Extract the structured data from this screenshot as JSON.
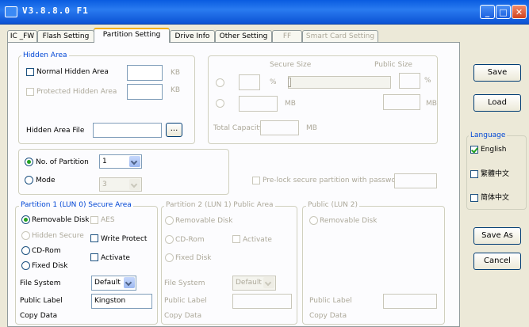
{
  "window": {
    "title": "V3.8.8.0 F1",
    "minimize": "_",
    "maximize": "□",
    "close": "✕"
  },
  "tabs": [
    {
      "label": "IC _FW",
      "state": "normal"
    },
    {
      "label": "Flash Setting",
      "state": "normal"
    },
    {
      "label": "Partition Setting",
      "state": "active"
    },
    {
      "label": "Drive Info",
      "state": "normal"
    },
    {
      "label": "Other Setting",
      "state": "normal"
    },
    {
      "label": "FF",
      "state": "disabled"
    },
    {
      "label": "Smart Card Setting",
      "state": "disabled"
    }
  ],
  "hidden_area": {
    "group_label": "Hidden Area",
    "normal_hidden_label": "Normal Hidden Area",
    "normal_hidden_unit": "KB",
    "protected_hidden_label": "Protected Hidden Area",
    "protected_hidden_unit": "KB",
    "file_label": "Hidden Area File",
    "browse_label": "...",
    "file_value": ""
  },
  "secure_size": {
    "secure_label": "Secure Size",
    "public_label": "Public Size",
    "percent_unit": "%",
    "mb_unit": "MB",
    "total_capacity_label": "Total Capacity",
    "total_capacity_unit": "MB"
  },
  "partition": {
    "no_label": "No. of Partition",
    "no_value": "1",
    "mode_label": "Mode",
    "mode_value": "3",
    "prelock_label": "Pre-lock secure partition with password :"
  },
  "lun0": {
    "group_label": "Partition 1 (LUN 0) Secure Area",
    "removable": "Removable Disk",
    "hidden_secure": "Hidden Secure",
    "cdrom": "CD-Rom",
    "fixed": "Fixed Disk",
    "aes": "AES",
    "write_protect": "Write Protect",
    "activate": "Activate",
    "file_system_label": "File System",
    "file_system_value": "Default",
    "public_label_label": "Public Label",
    "public_label_value": "Kingston",
    "copy_data_label": "Copy Data"
  },
  "lun1": {
    "group_label": "Partition 2 (LUN 1) Public Area",
    "removable": "Removable Disk",
    "cdrom": "CD-Rom",
    "activate": "Activate",
    "fixed": "Fixed Disk",
    "file_system_label": "File System",
    "file_system_value": "Default",
    "public_label_label": "Public Label",
    "copy_data_label": "Copy Data"
  },
  "lun2": {
    "group_label": "Public (LUN 2)",
    "removable": "Removable Disk",
    "public_label_label": "Public Label",
    "copy_data_label": "Copy Data"
  },
  "side": {
    "save": "Save",
    "load": "Load",
    "language_label": "Language",
    "english": "English",
    "trad_chinese": "繁體中文",
    "simp_chinese": "简体中文",
    "save_as": "Save As",
    "cancel": "Cancel"
  },
  "colors": {
    "titlebar": "#0a5ce0",
    "group_label": "#0046d5",
    "check_mark": "#21a121"
  }
}
